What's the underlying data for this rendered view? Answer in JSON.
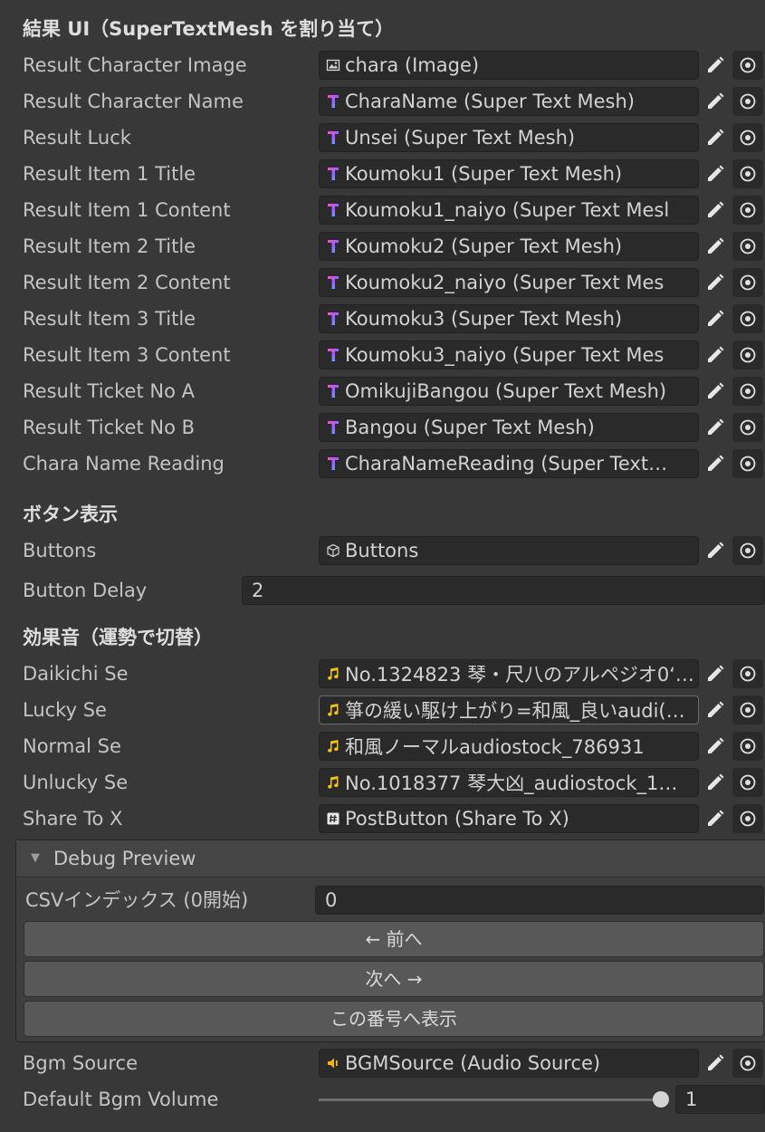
{
  "sections": {
    "result_ui": "結果 UI（SuperTextMesh を割り当て）",
    "button_display": "ボタン表示",
    "sound_effects": "効果音（運勢で切替）"
  },
  "result_fields": [
    {
      "label": "Result Character Image",
      "value": "chara (Image)",
      "icon": "image-icon"
    },
    {
      "label": "Result Character Name",
      "value": "CharaName (Super Text Mesh)",
      "icon": "super-text-mesh-icon"
    },
    {
      "label": "Result Luck",
      "value": "Unsei (Super Text Mesh)",
      "icon": "super-text-mesh-icon"
    },
    {
      "label": "Result Item 1 Title",
      "value": "Koumoku1 (Super Text Mesh)",
      "icon": "super-text-mesh-icon"
    },
    {
      "label": "Result Item 1 Content",
      "value": "Koumoku1_naiyo (Super Text Mesl",
      "icon": "super-text-mesh-icon"
    },
    {
      "label": "Result Item 2 Title",
      "value": "Koumoku2 (Super Text Mesh)",
      "icon": "super-text-mesh-icon"
    },
    {
      "label": "Result Item 2 Content",
      "value": "Koumoku2_naiyo (Super Text Mes",
      "icon": "super-text-mesh-icon"
    },
    {
      "label": "Result Item 3 Title",
      "value": "Koumoku3 (Super Text Mesh)",
      "icon": "super-text-mesh-icon"
    },
    {
      "label": "Result Item 3 Content",
      "value": "Koumoku3_naiyo (Super Text Mes",
      "icon": "super-text-mesh-icon"
    },
    {
      "label": "Result Ticket No A",
      "value": "OmikujiBangou (Super Text Mesh)",
      "icon": "super-text-mesh-icon"
    },
    {
      "label": "Result Ticket No B",
      "value": "Bangou (Super Text Mesh)",
      "icon": "super-text-mesh-icon"
    },
    {
      "label": "Chara Name Reading",
      "value": "CharaNameReading (Super Text…",
      "icon": "super-text-mesh-icon"
    }
  ],
  "buttons": {
    "label": "Buttons",
    "value": "Buttons",
    "icon": "gameobject-icon"
  },
  "button_delay": {
    "label": "Button Delay",
    "value": "2"
  },
  "se_fields": [
    {
      "label": "Daikichi Se",
      "value": "No.1324823 琴・尺八のアルペジオ0‘…",
      "icon": "audio-clip-icon"
    },
    {
      "label": "Lucky Se",
      "value": "箏の緩い駆け上がり=和風_良いaudi(…",
      "icon": "audio-clip-icon"
    },
    {
      "label": "Normal Se",
      "value": "和風ノーマルaudiostock_786931",
      "icon": "audio-clip-icon"
    },
    {
      "label": "Unlucky Se",
      "value": "No.1018377 琴大凶_audiostock_1…",
      "icon": "audio-clip-icon"
    },
    {
      "label": "Share To X",
      "value": "PostButton (Share To X)",
      "icon": "script-icon"
    }
  ],
  "debug": {
    "title": "Debug Preview",
    "csv_label": "CSVインデックス (0開始)",
    "csv_value": "0",
    "prev": "← 前へ",
    "next": "次へ →",
    "show": "この番号へ表示"
  },
  "bgm_source": {
    "label": "Bgm Source",
    "value": "BGMSource (Audio Source)",
    "icon": "audio-source-icon"
  },
  "default_bgm_volume": {
    "label": "Default Bgm Volume",
    "value": "1",
    "level": 1
  }
}
